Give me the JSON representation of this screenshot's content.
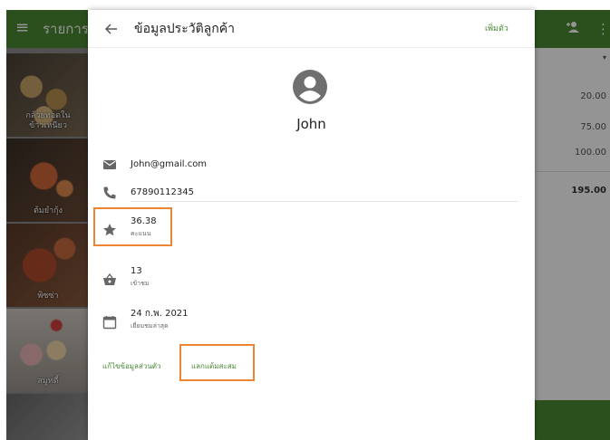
{
  "background": {
    "header_title": "รายการ",
    "menu_icon": "menu-icon",
    "header_icons": [
      "add-person-icon",
      "more-vert-icon"
    ],
    "foods": [
      {
        "label": "กล้วยทอดใน\nข้าวเหนียว"
      },
      {
        "label": "ต้มยำกุ้ง"
      },
      {
        "label": "พิซซ่า"
      },
      {
        "label": "สมูทตี้"
      }
    ],
    "right_values": [
      "20.00",
      "75.00",
      "100.00"
    ],
    "right_total": "195.00"
  },
  "dialog": {
    "title": "ข้อมูลประวัติลูกค้า",
    "add_label": "เพิ่มตัว",
    "customer": {
      "name": "John",
      "email": "John@gmail.com",
      "phone": "67890112345"
    },
    "stats": {
      "points": {
        "value": "36.38",
        "label": "คะแนน"
      },
      "visits": {
        "value": "13",
        "label": "เข้าชม"
      },
      "last_visit": {
        "value": "24 ก.พ. 2021",
        "label": "เยี่ยมชมล่าสุด"
      }
    },
    "actions": {
      "edit_label": "แก้ไขข้อมูลส่วนตัว",
      "redeem_label": "แลกแต้มสะสม"
    }
  },
  "colors": {
    "accent": "#4a8a34",
    "highlight": "#ee8533",
    "icon_gray": "#666666"
  }
}
